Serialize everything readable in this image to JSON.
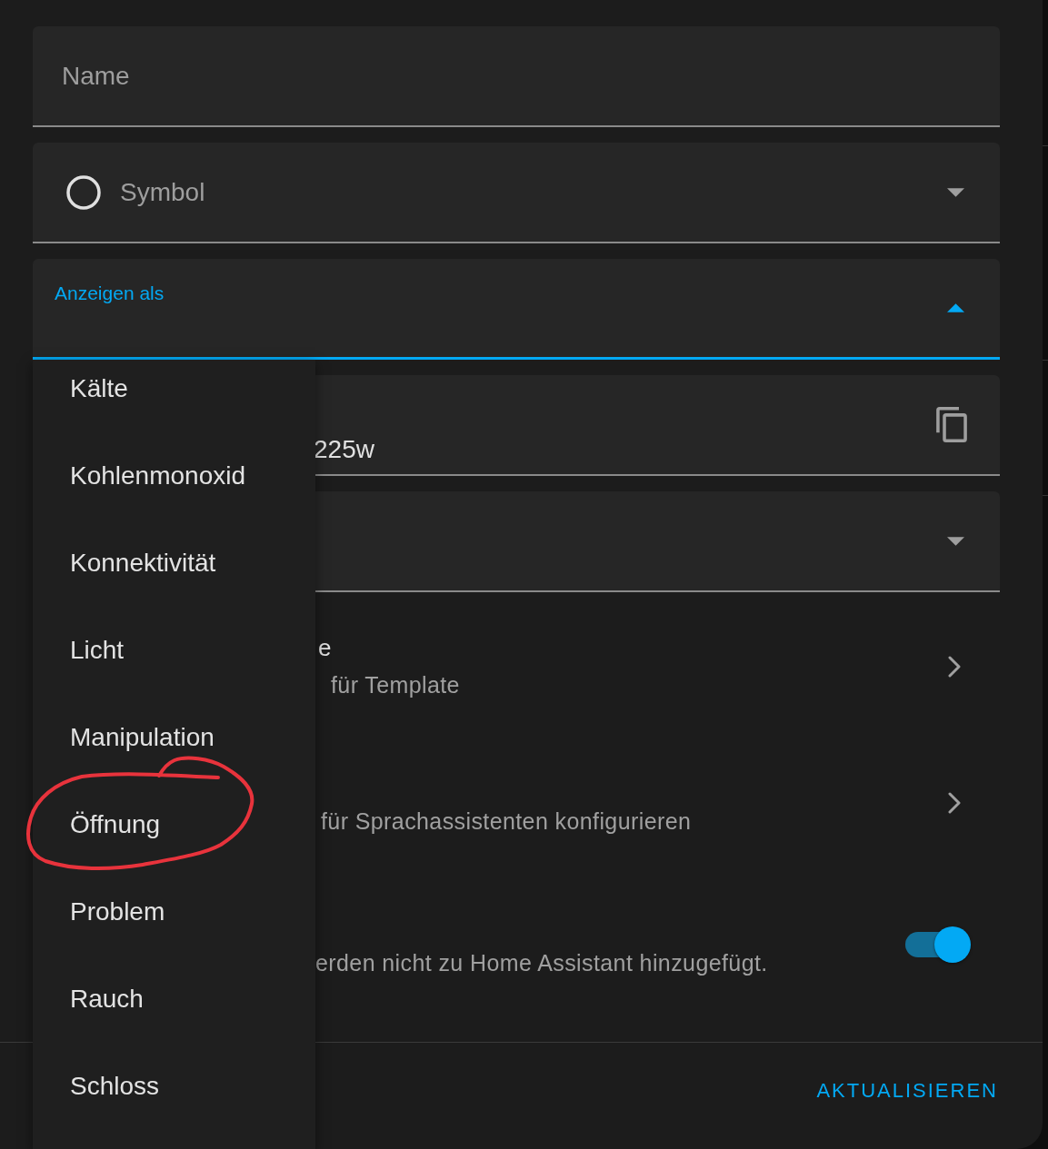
{
  "form": {
    "fields": [
      {
        "kind": "text",
        "label": "Name"
      },
      {
        "kind": "icon-select",
        "label": "Symbol",
        "expanded": false
      },
      {
        "kind": "select",
        "label": "Anzeigen als",
        "expanded": true
      },
      {
        "kind": "copy",
        "value": "225w"
      },
      {
        "kind": "select",
        "expanded": false
      }
    ]
  },
  "menu": {
    "items": [
      {
        "label": "Kälte",
        "selected": false,
        "circled": false
      },
      {
        "label": "Kohlenmonoxid",
        "selected": false,
        "circled": false
      },
      {
        "label": "Konnektivität",
        "selected": false,
        "circled": false
      },
      {
        "label": "Licht",
        "selected": false,
        "circled": false
      },
      {
        "label": "Manipulation",
        "selected": false,
        "circled": false
      },
      {
        "label": "Öffnung",
        "selected": false,
        "circled": true
      },
      {
        "label": "Problem",
        "selected": false,
        "circled": false
      },
      {
        "label": "Rauch",
        "selected": false,
        "circled": false
      },
      {
        "label": "Schloss",
        "selected": false,
        "circled": false
      }
    ]
  },
  "rows": [
    {
      "kind": "link",
      "title": "e",
      "subtitle": "für Template"
    },
    {
      "kind": "link",
      "subtitle": "für Sprachassistenten konfigurieren"
    },
    {
      "kind": "toggle",
      "subtitle": "erden nicht zu Home Assistant hinzugefügt.",
      "on": true
    }
  ],
  "footer": {
    "button": "AKTUALISIEREN"
  }
}
